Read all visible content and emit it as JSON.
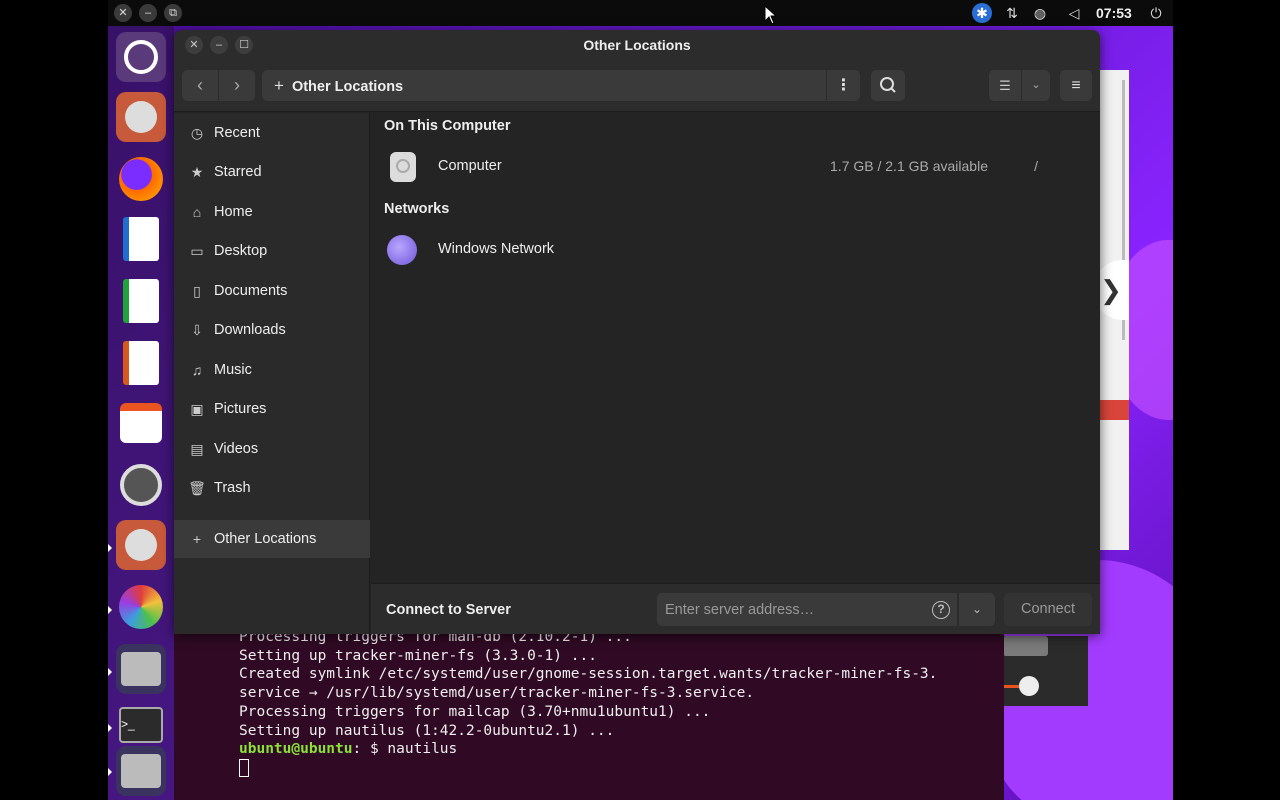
{
  "topbar": {
    "close": "✕",
    "minimize": "–",
    "restore": "⧉",
    "time": "07:53"
  },
  "window": {
    "title": "Other Locations",
    "close": "✕",
    "minimize": "–",
    "maximize": "☐"
  },
  "toolbar": {
    "back": "‹",
    "forward": "›",
    "path_plus": "+",
    "path_label": "Other Locations",
    "path_menu": "⋮",
    "view_icon": "☰",
    "view_drop": "⌄",
    "menu": "≡"
  },
  "sidebar": {
    "items": [
      {
        "label": "Recent",
        "icon": "clock-icon",
        "glyph": "◷"
      },
      {
        "label": "Starred",
        "icon": "star-icon",
        "glyph": "★"
      },
      {
        "label": "Home",
        "icon": "home-icon",
        "glyph": "⌂"
      },
      {
        "label": "Desktop",
        "icon": "desktop-icon",
        "glyph": "▭"
      },
      {
        "label": "Documents",
        "icon": "document-icon",
        "glyph": "▯"
      },
      {
        "label": "Downloads",
        "icon": "download-icon",
        "glyph": "⇩"
      },
      {
        "label": "Music",
        "icon": "music-icon",
        "glyph": "♫"
      },
      {
        "label": "Pictures",
        "icon": "picture-icon",
        "glyph": "▣"
      },
      {
        "label": "Videos",
        "icon": "video-icon",
        "glyph": "▤"
      },
      {
        "label": "Trash",
        "icon": "trash-icon",
        "glyph": "🗑"
      }
    ],
    "other": {
      "label": "Other Locations",
      "glyph": "+"
    }
  },
  "content": {
    "on_this_computer": "On This Computer",
    "computer": {
      "name": "Computer",
      "space": "1.7 GB / 2.1 GB available",
      "path": "/"
    },
    "networks": "Networks",
    "windows_network": {
      "name": "Windows Network"
    }
  },
  "connect": {
    "label": "Connect to Server",
    "placeholder": "Enter server address…",
    "help": "?",
    "drop": "⌄",
    "button": "Connect"
  },
  "terminal": {
    "lines": [
      "Processing triggers for man-db (2.10.2-1) ...",
      "Setting up tracker-miner-fs (3.3.0-1) ...",
      "Created symlink /etc/systemd/user/gnome-session.target.wants/tracker-miner-fs-3.",
      "service → /usr/lib/systemd/user/tracker-miner-fs-3.service.",
      "Processing triggers for mailcap (3.70+nmu1ubuntu1) ...",
      "Setting up nautilus (1:42.2-0ubuntu2.1) ..."
    ],
    "prompt_user": "ubuntu@ubuntu",
    "prompt_rest": ": $ nautilus"
  },
  "colors": {
    "accent": "#e95420",
    "prompt": "#8ae234",
    "terminal_bg": "#300a24"
  }
}
